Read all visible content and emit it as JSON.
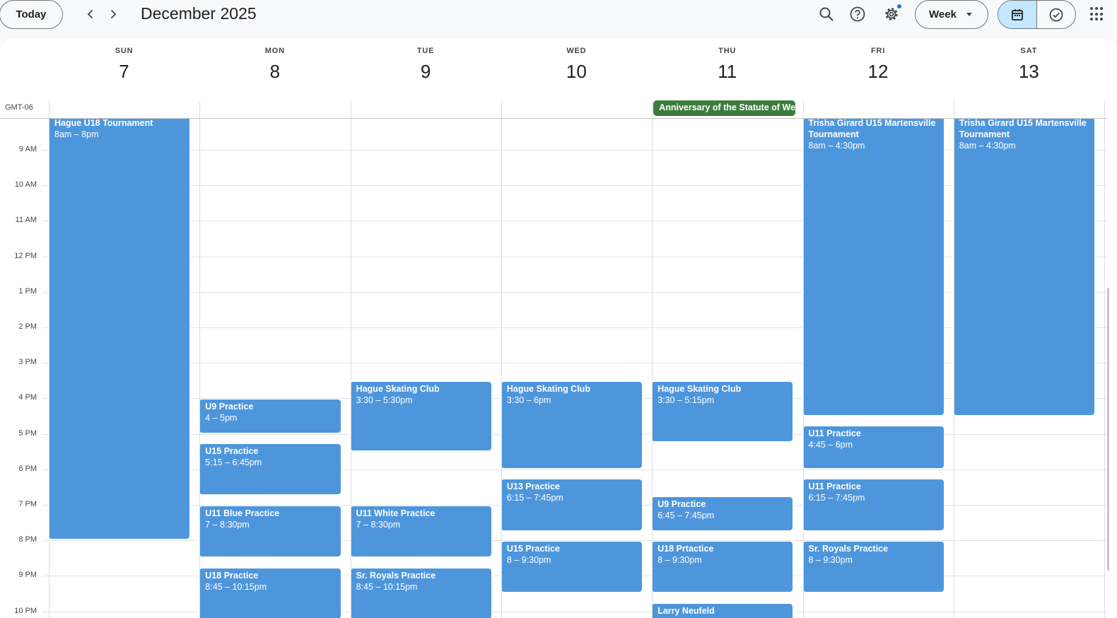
{
  "header": {
    "today_label": "Today",
    "prev_icon": "chevron-left-icon",
    "next_icon": "chevron-right-icon",
    "month_title": "December 2025",
    "search_icon": "search-icon",
    "help_icon": "help-icon",
    "settings_icon": "gear-icon",
    "view_label": "Week",
    "calendar_toggle_icon": "calendar-icon",
    "tasks_toggle_icon": "check-circle-icon",
    "apps_icon": "apps-grid-icon"
  },
  "timezone": "GMT-06",
  "days": [
    {
      "dow": "SUN",
      "num": "7"
    },
    {
      "dow": "MON",
      "num": "8"
    },
    {
      "dow": "TUE",
      "num": "9"
    },
    {
      "dow": "WED",
      "num": "10"
    },
    {
      "dow": "THU",
      "num": "11"
    },
    {
      "dow": "FRI",
      "num": "12"
    },
    {
      "dow": "SAT",
      "num": "13"
    }
  ],
  "hours": [
    "9 AM",
    "10 AM",
    "11 AM",
    "12 PM",
    "1 PM",
    "2 PM",
    "3 PM",
    "4 PM",
    "5 PM",
    "6 PM",
    "7 PM",
    "8 PM",
    "9 PM",
    "10 PM"
  ],
  "all_day_events": [
    {
      "day": 4,
      "title": "Anniversary of the Statute of Westminster",
      "color": "#3c7d3c"
    }
  ],
  "events": [
    {
      "day": 0,
      "title": "Hague U18 Tournament",
      "time": "8am – 8pm",
      "start": 8,
      "end": 20
    },
    {
      "day": 1,
      "title": "U9 Practice",
      "time": "4 – 5pm",
      "start": 16,
      "end": 17
    },
    {
      "day": 1,
      "title": "U15 Practice",
      "time": "5:15 – 6:45pm",
      "start": 17.25,
      "end": 18.75
    },
    {
      "day": 1,
      "title": "U11 Blue Practice",
      "time": "7 – 8:30pm",
      "start": 19,
      "end": 20.5
    },
    {
      "day": 1,
      "title": "U18 Practice",
      "time": "8:45 – 10:15pm",
      "start": 20.75,
      "end": 22.25
    },
    {
      "day": 2,
      "title": "Hague Skating Club",
      "time": "3:30 – 5:30pm",
      "start": 15.5,
      "end": 17.5
    },
    {
      "day": 2,
      "title": "U11 White Practice",
      "time": "7 – 8:30pm",
      "start": 19,
      "end": 20.5
    },
    {
      "day": 2,
      "title": "Sr. Royals Practice",
      "time": "8:45 – 10:15pm",
      "start": 20.75,
      "end": 22.25
    },
    {
      "day": 3,
      "title": "Hague Skating Club",
      "time": "3:30 – 6pm",
      "start": 15.5,
      "end": 18
    },
    {
      "day": 3,
      "title": "U13 Practice",
      "time": "6:15 – 7:45pm",
      "start": 18.25,
      "end": 19.75
    },
    {
      "day": 3,
      "title": "U15 Practice",
      "time": "8 – 9:30pm",
      "start": 20,
      "end": 21.5
    },
    {
      "day": 4,
      "title": "Hague Skating Club",
      "time": "3:30 – 5:15pm",
      "start": 15.5,
      "end": 17.25
    },
    {
      "day": 4,
      "title": "U9 Practice",
      "time": "6:45 – 7:45pm",
      "start": 18.75,
      "end": 19.75
    },
    {
      "day": 4,
      "title": "U18 Prtactice",
      "time": "8 – 9:30pm",
      "start": 20,
      "end": 21.5
    },
    {
      "day": 4,
      "title": "Larry Neufeld",
      "time": "",
      "start": 21.75,
      "end": 23
    },
    {
      "day": 5,
      "title": "Trisha Girard U15 Martensville Tournament",
      "time": "8am – 4:30pm",
      "start": 8,
      "end": 16.5
    },
    {
      "day": 5,
      "title": "U11 Practice",
      "time": "4:45 – 6pm",
      "start": 16.75,
      "end": 18
    },
    {
      "day": 5,
      "title": "U11 Practice",
      "time": "6:15 – 7:45pm",
      "start": 18.25,
      "end": 19.75
    },
    {
      "day": 5,
      "title": "Sr. Royals Practice",
      "time": "8 – 9:30pm",
      "start": 20,
      "end": 21.5
    },
    {
      "day": 6,
      "title": "Trisha Girard U15 Martensville Tournament",
      "time": "8am – 4:30pm",
      "start": 8,
      "end": 16.5
    }
  ],
  "colors": {
    "event": "#4e96dc",
    "holiday": "#3c7d3c",
    "accent": "#c2e7ff"
  }
}
